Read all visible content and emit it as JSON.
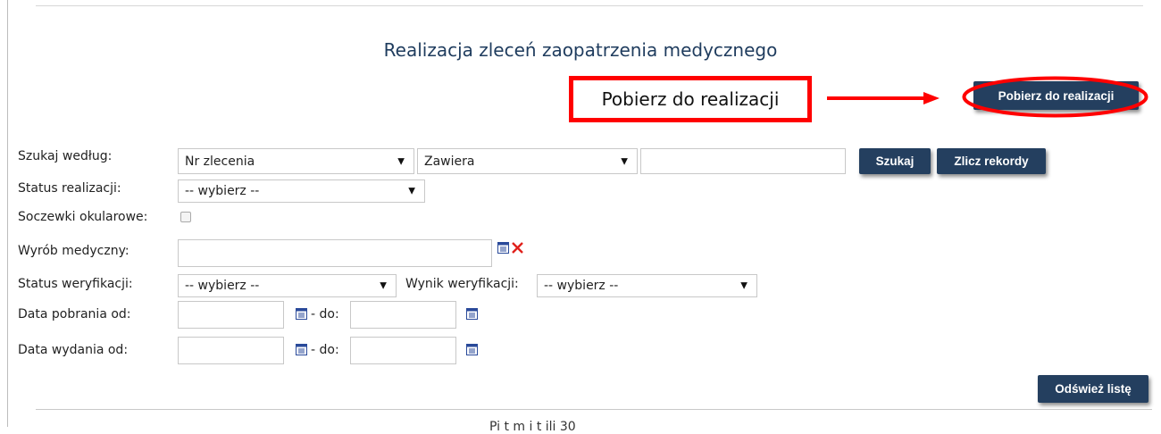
{
  "header": {
    "title": "Realizacja zleceń zaopatrzenia medycznego"
  },
  "annotation": {
    "callout_text": "Pobierz do realizacji",
    "highlight_color": "#ff0000"
  },
  "actions": {
    "pobierz_label": "Pobierz do realizacji",
    "szukaj_label": "Szukaj",
    "zlicz_label": "Zlicz rekordy",
    "odswiez_label": "Odśwież listę"
  },
  "filters": {
    "search_by": {
      "label": "Szukaj według:",
      "field_value": "Nr zlecenia",
      "operator_value": "Zawiera",
      "text_value": ""
    },
    "status_realizacji": {
      "label": "Status realizacji:",
      "value": "-- wybierz --"
    },
    "soczewki": {
      "label": "Soczewki okularowe:",
      "checked": false
    },
    "wyrob": {
      "label": "Wyrób medyczny:",
      "value": ""
    },
    "status_weryfikacji": {
      "label": "Status weryfikacji:",
      "value": "-- wybierz --"
    },
    "wynik_weryfikacji": {
      "label": "Wynik weryfikacji:",
      "value": "-- wybierz --"
    },
    "data_pobrania": {
      "label": "Data pobrania od:",
      "to_label": "- do:",
      "from_value": "",
      "to_value": ""
    },
    "data_wydania": {
      "label": "Data wydania od:",
      "to_label": "- do:",
      "from_value": "",
      "to_value": ""
    }
  },
  "footer": {
    "partial_text": "Pi  t  m   i     t     ili     30"
  },
  "colors": {
    "button_bg": "#243f5f",
    "title_color": "#1f3c5e",
    "icon_blue": "#2a4a9a",
    "clear_red": "#e0201b"
  }
}
